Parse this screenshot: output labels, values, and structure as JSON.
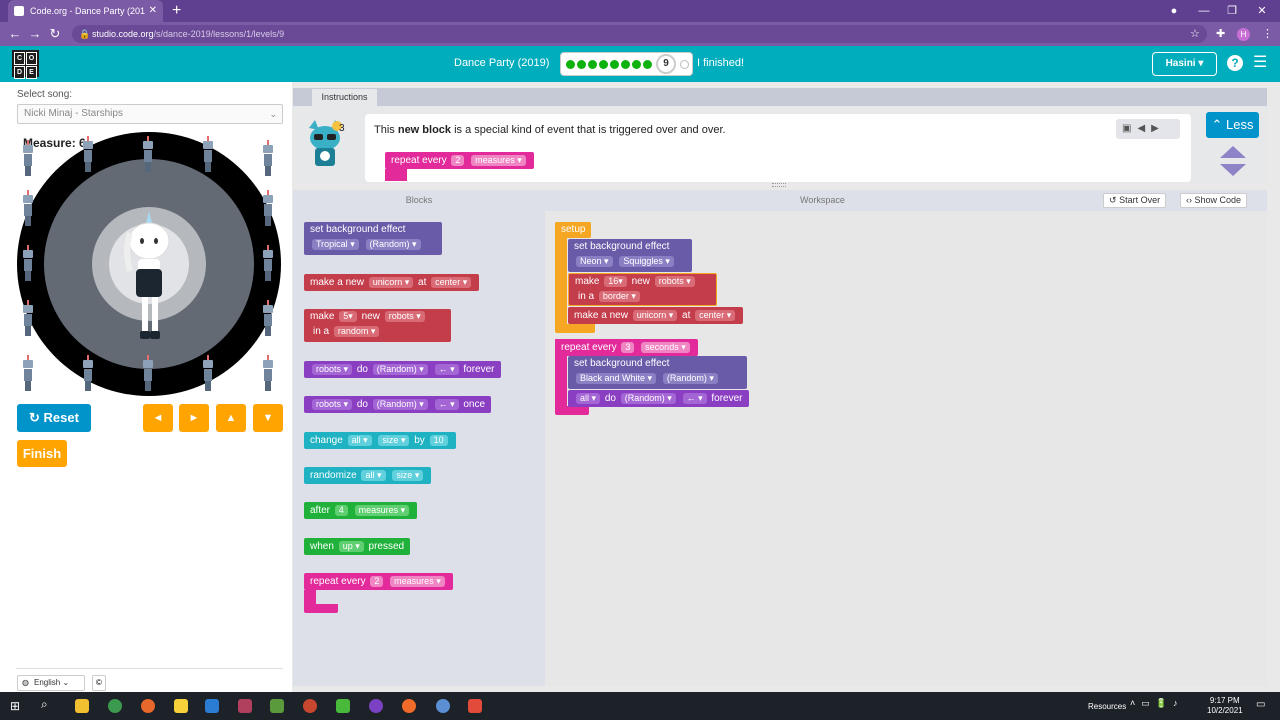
{
  "browser": {
    "tab_title": "Code.org - Dance Party (201",
    "url_domain": "studio.code.org",
    "url_path": "/s/dance-2019/lessons/1/levels/9",
    "profile_initial": "H"
  },
  "header": {
    "lesson_title": "Dance Party (2019)",
    "current_level": "9",
    "finished_label": "I finished!",
    "user_name": "Hasini",
    "logo_letters": [
      "C",
      "O",
      "D",
      "E"
    ],
    "completed_levels": 8
  },
  "left_panel": {
    "select_song_label": "Select song:",
    "song_value": "Nicki Minaj - Starships",
    "measure_label": "Measure: 6",
    "reset_label": "Reset",
    "finish_label": "Finish",
    "language": "English",
    "arrows": [
      "◄",
      "►",
      "▲",
      "▼"
    ]
  },
  "instructions": {
    "tab_label": "Instructions",
    "text_before": "This ",
    "text_bold": "new block",
    "text_after": " is a special kind of event that is triggered over and over.",
    "example_block": {
      "text": "repeat every",
      "num": "2",
      "unit": "measures"
    },
    "less_label": "Less"
  },
  "panels": {
    "blocks_label": "Blocks",
    "workspace_label": "Workspace",
    "start_over_label": "Start Over",
    "show_code_label": "Show Code"
  },
  "toolbox": [
    {
      "color": "purple",
      "l1": "set background effect",
      "f1": "Tropical",
      "f2": "(Random)"
    },
    {
      "color": "red",
      "t1": "make a new",
      "f1": "unicorn",
      "t2": "at",
      "f2": "center"
    },
    {
      "color": "red",
      "t1": "make",
      "f1": "5",
      "t2": "new",
      "f2": "robots",
      "t3": "in a",
      "f3": "random"
    },
    {
      "color": "rob",
      "f1": "robots",
      "t1": "do",
      "f2": "(Random)",
      "f3": "←",
      "t2": "forever"
    },
    {
      "color": "rob",
      "f1": "robots",
      "t1": "do",
      "f2": "(Random)",
      "f3": "←",
      "t2": "once"
    },
    {
      "color": "teal",
      "t1": "change",
      "f1": "all",
      "f2": "size",
      "t2": "by",
      "f3": "10"
    },
    {
      "color": "teal",
      "t1": "randomize",
      "f1": "all",
      "f2": "size"
    },
    {
      "color": "green",
      "t1": "after",
      "f1": "4",
      "f2": "measures"
    },
    {
      "color": "green",
      "t1": "when",
      "f1": "up",
      "t2": "pressed"
    },
    {
      "color": "pink",
      "t1": "repeat every",
      "f1": "2",
      "f2": "measures"
    }
  ],
  "workspace": {
    "setup_label": "setup",
    "s1": {
      "l1": "set background effect",
      "f1": "Neon",
      "f2": "Squiggles"
    },
    "s2": {
      "t1": "make",
      "f1": "16",
      "t2": "new",
      "f2": "robots",
      "t3": "in a",
      "f3": "border"
    },
    "s3": {
      "t1": "make a new",
      "f1": "unicorn",
      "t2": "at",
      "f2": "center"
    },
    "repeat": {
      "t1": "repeat every",
      "f1": "3",
      "f2": "seconds"
    },
    "r1": {
      "l1": "set background effect",
      "f1": "Black and White",
      "f2": "(Random)"
    },
    "r2": {
      "f1": "all",
      "t1": "do",
      "f2": "(Random)",
      "f3": "←",
      "t2": "forever"
    }
  },
  "taskbar": {
    "resources_label": "Resources",
    "time": "9:17 PM",
    "date": "10/2/2021"
  }
}
